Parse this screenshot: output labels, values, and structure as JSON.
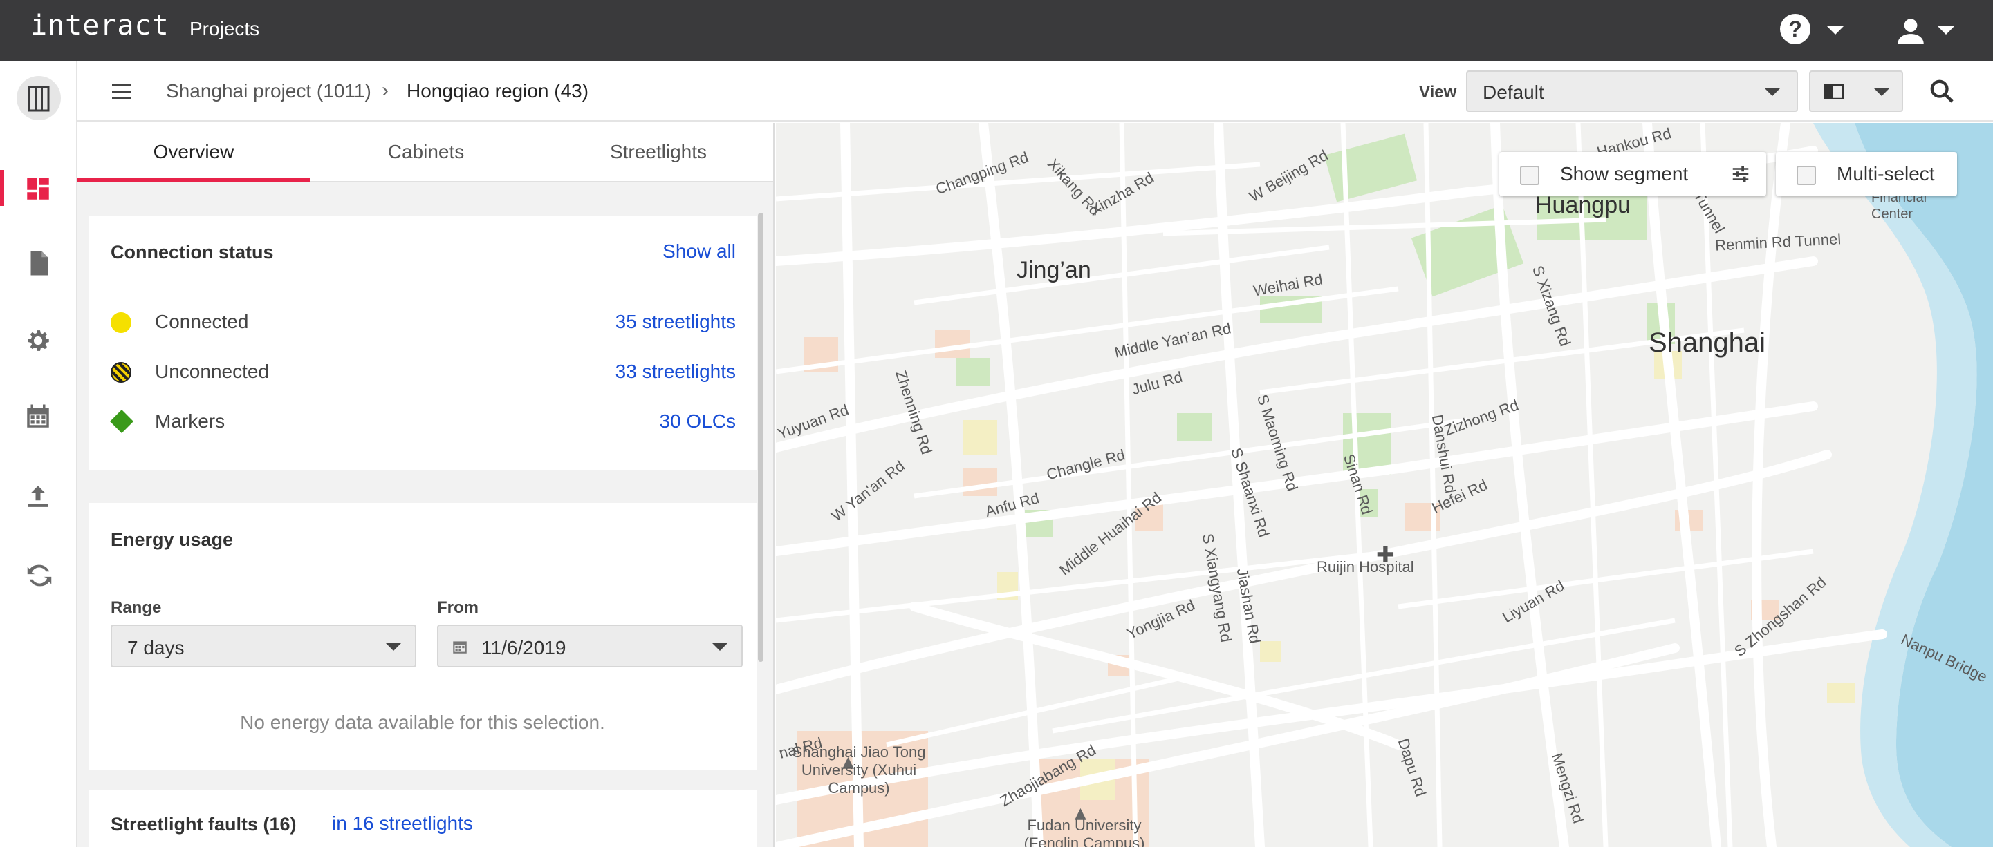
{
  "app": {
    "brand": "interact",
    "nav_projects": "Projects"
  },
  "breadcrumb": {
    "project": "Shanghai project (1011)",
    "separator": "›",
    "region": "Hongqiao region (43)"
  },
  "view": {
    "label": "View",
    "selected": "Default"
  },
  "tabs": [
    {
      "label": "Overview",
      "active": true
    },
    {
      "label": "Cabinets",
      "active": false
    },
    {
      "label": "Streetlights",
      "active": false
    }
  ],
  "connection_status": {
    "title": "Connection status",
    "show_all": "Show all",
    "rows": [
      {
        "label": "Connected",
        "count": "35 streetlights",
        "marker": "yellow-dot"
      },
      {
        "label": "Unconnected",
        "count": "33 streetlights",
        "marker": "striped-dot"
      },
      {
        "label": "Markers",
        "count": "30 OLCs",
        "marker": "green-diamond"
      }
    ]
  },
  "energy_usage": {
    "title": "Energy usage",
    "range_label": "Range",
    "range_value": "7 days",
    "from_label": "From",
    "from_value": "11/6/2019",
    "empty_message": "No energy data available for this selection."
  },
  "faults": {
    "title": "Streetlight faults (16)",
    "link": "in 16 streetlights"
  },
  "map": {
    "show_segment": "Show segment",
    "multi_select": "Multi-select",
    "labels": {
      "huangpu": "Huangpu",
      "jingan": "Jing’an",
      "shanghai": "Shanghai",
      "hankou": "Hankou Rd",
      "changping": "Changping Rd",
      "xikang": "Xikang Rd",
      "xinzha": "Xinzha Rd",
      "wbeijing": "W Beijing Rd",
      "weihai": "Weihai Rd",
      "middleyanan": "Middle Yan’an Rd",
      "julu": "Julu Rd",
      "sxizang": "S Xizang Rd",
      "renmin": "Renmin Rd Tunnel",
      "worldfin": "World Financial Center",
      "tunnel": "Tunnel",
      "yuyuan": "Yuyuan Rd",
      "zhenning": "Zhenning Rd",
      "wyanan": "W Yan'an Rd",
      "changle": "Changle Rd",
      "anfu": "Anfu Rd",
      "middlehuaihai": "Middle Huaihai Rd",
      "smaoming": "S Maoming Rd",
      "sshaanxi": "S Shaanxi Rd",
      "sinan": "Sinan Rd",
      "danshui": "Danshui Rd",
      "zizhong": "Zizhong Rd",
      "hefei": "Hefei Rd",
      "ruijin": "Ruijin Hospital",
      "sxiangyang": "S Xiangyang Rd",
      "jiashan": "Jiashan Rd",
      "yongjia": "Yongjia Rd",
      "liyuan": "Liyuan Rd",
      "szhongshan": "S Zhongshan Rd",
      "nanpu": "Nanpu Bridge",
      "jiaotong": "Shanghai Jiao Tong University (Xuhui Campus)",
      "fudan": "Fudan University (Fenglin Campus)",
      "zhaojiabang": "Zhaojiabang Rd",
      "dapu": "Dapu Rd",
      "mengzi": "Mengzi Rd",
      "rdedge": "nal Rd"
    }
  }
}
